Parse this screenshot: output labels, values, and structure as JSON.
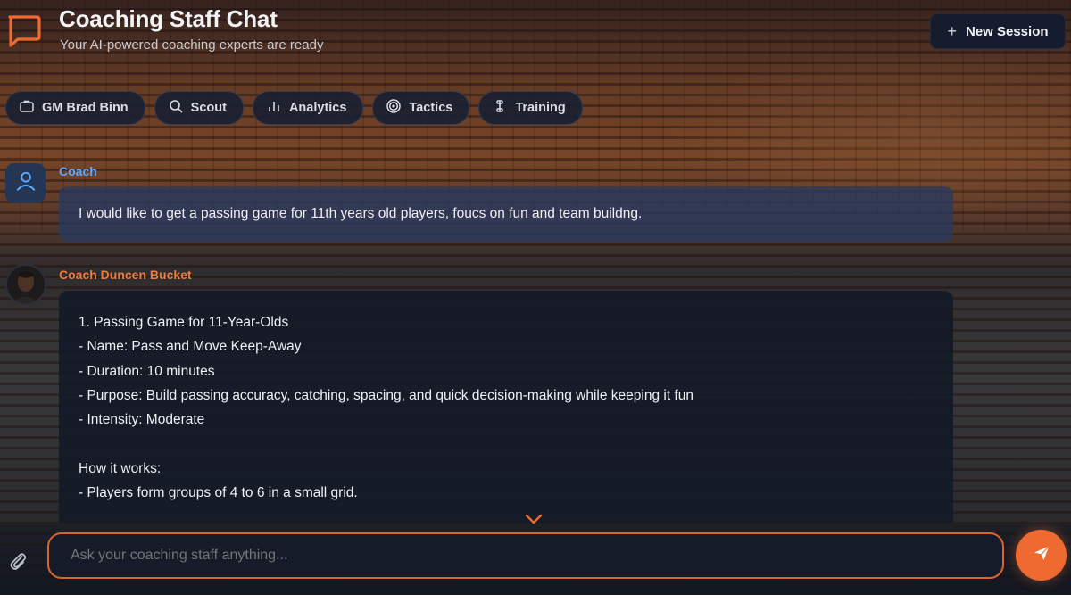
{
  "header": {
    "title": "Coaching Staff Chat",
    "subtitle": "Your AI-powered coaching experts are ready",
    "new_session_label": "New Session",
    "accent_color": "#ee6a30"
  },
  "tabs": [
    {
      "label": "GM Brad Binn",
      "icon": "briefcase-icon"
    },
    {
      "label": "Scout",
      "icon": "search-icon"
    },
    {
      "label": "Analytics",
      "icon": "bar-chart-icon"
    },
    {
      "label": "Tactics",
      "icon": "target-icon"
    },
    {
      "label": "Training",
      "icon": "dumbbell-icon"
    }
  ],
  "messages": [
    {
      "sender": "Coach",
      "text": "I would like to get a passing game for 11th years old players, foucs on fun and team buildng."
    },
    {
      "sender": "Coach Duncen Bucket",
      "lines": [
        "1. Passing Game for 11-Year-Olds",
        "- Name: Pass and Move Keep-Away",
        "- Duration: 10 minutes",
        "- Purpose: Build passing accuracy, catching, spacing, and quick decision-making while keeping it fun",
        "- Intensity: Moderate",
        "",
        "How it works:",
        "- Players form groups of 4 to 6 in a small grid."
      ]
    }
  ],
  "composer": {
    "placeholder": "Ask your coaching staff anything...",
    "value": ""
  }
}
